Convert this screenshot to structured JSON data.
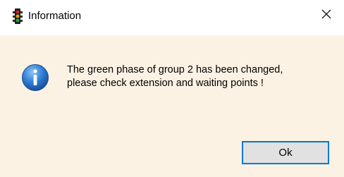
{
  "window": {
    "title": "Information",
    "app_icon": "traffic-light-icon",
    "close_icon": "close-icon"
  },
  "message": {
    "icon": "info-icon",
    "line1": "The green phase of group 2 has been changed,",
    "line2": "please check extension and waiting points !"
  },
  "buttons": {
    "ok_label": "Ok"
  },
  "colors": {
    "body_background": "#fcf2e4",
    "titlebar_background": "#ffffff",
    "button_border": "#0078d7",
    "button_background": "#e1e1e1"
  }
}
